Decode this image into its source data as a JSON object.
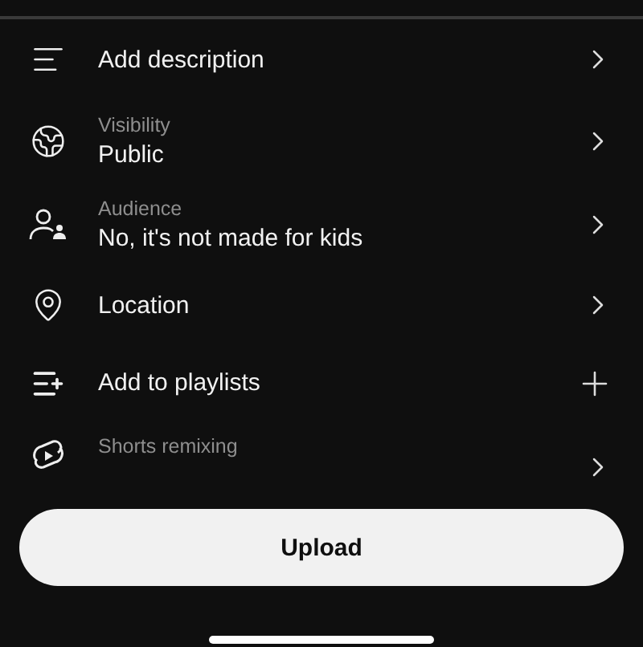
{
  "rows": [
    {
      "kind": "chevron",
      "title": "Add description"
    },
    {
      "kind": "chevron",
      "label": "Visibility",
      "title": "Public"
    },
    {
      "kind": "chevron",
      "label": "Audience",
      "title": "No, it's not made for kids"
    },
    {
      "kind": "chevron",
      "title": "Location"
    },
    {
      "kind": "plus",
      "title": "Add to playlists"
    },
    {
      "kind": "chevron",
      "label": "Shorts remixing"
    }
  ],
  "upload_button": "Upload"
}
